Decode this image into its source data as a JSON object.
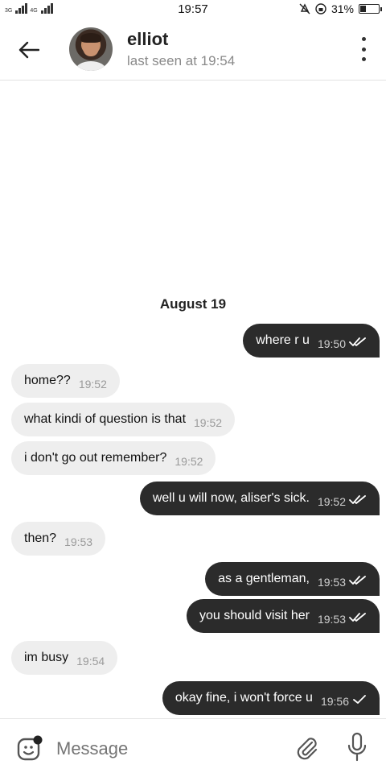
{
  "status_bar": {
    "sim1_label": "3G",
    "sim2_label": "4G",
    "time": "19:57",
    "battery_percent": "31%",
    "battery_level": 0.31
  },
  "header": {
    "contact_name": "elliot",
    "last_seen": "last seen at 19:54"
  },
  "chat": {
    "date_divider": "August 19",
    "messages": [
      {
        "direction": "out",
        "text": "where r u",
        "time": "19:50",
        "status": "read"
      },
      {
        "direction": "in",
        "text": "home??",
        "time": "19:52"
      },
      {
        "direction": "in",
        "text": "what kindi of question is that",
        "time": "19:52"
      },
      {
        "direction": "in",
        "text": "i don't go out remember?",
        "time": "19:52"
      },
      {
        "direction": "out",
        "text": "well u will now, aliser's sick.",
        "time": "19:52",
        "status": "read"
      },
      {
        "direction": "in",
        "text": "then?",
        "time": "19:53"
      },
      {
        "direction": "out",
        "text": "as a gentleman,",
        "time": "19:53",
        "status": "read"
      },
      {
        "direction": "out",
        "text": "you should visit her",
        "time": "19:53",
        "status": "read"
      },
      {
        "direction": "in",
        "text": "im busy",
        "time": "19:54"
      },
      {
        "direction": "out",
        "text": "okay fine, i won't force u",
        "time": "19:56",
        "status": "sent"
      }
    ]
  },
  "composer": {
    "placeholder": "Message"
  },
  "colors": {
    "incoming_bubble": "#eeeeee",
    "outgoing_bubble": "#2b2b2b"
  }
}
